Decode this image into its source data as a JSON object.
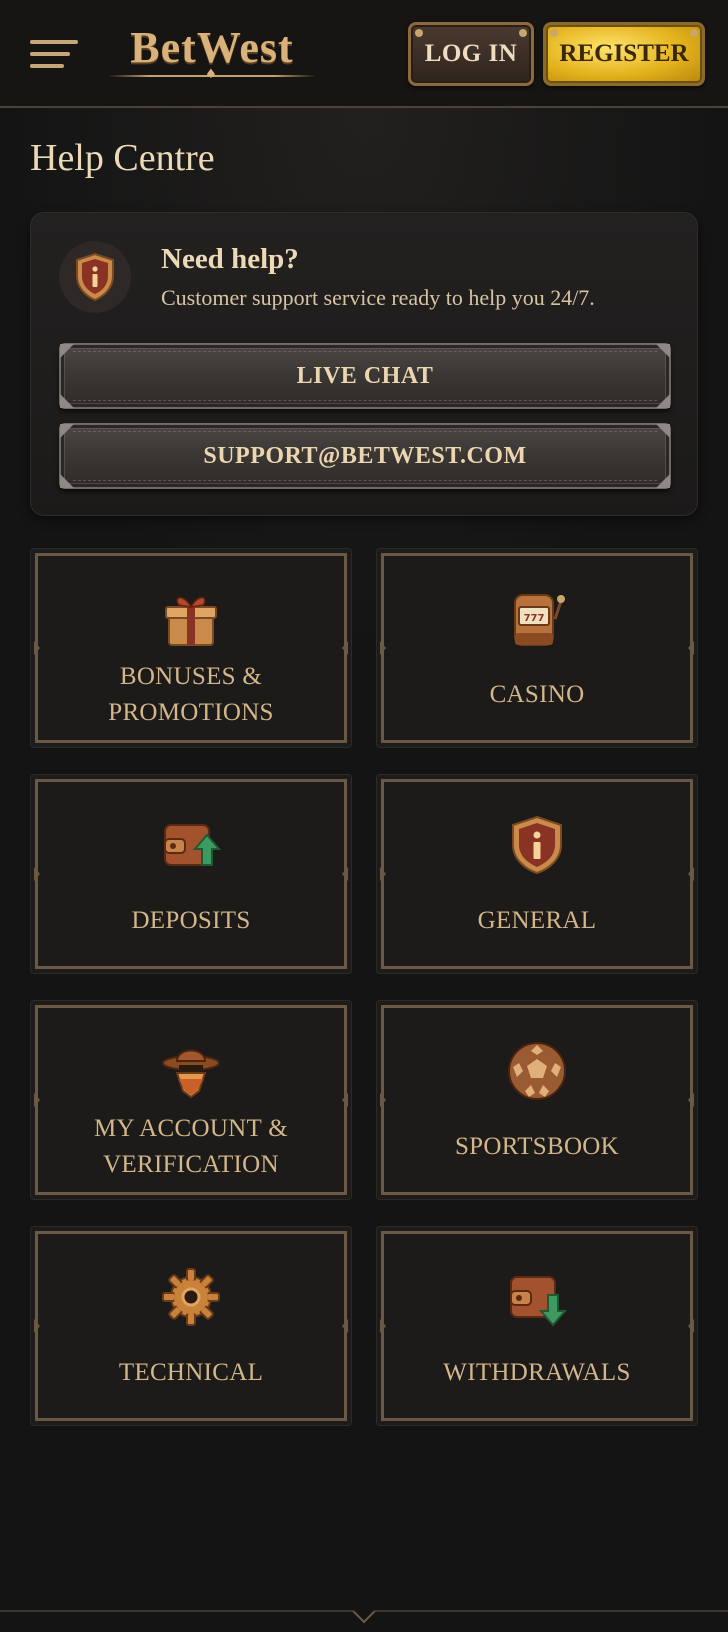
{
  "header": {
    "logo_text": "BetWest",
    "login_label": "LOG IN",
    "register_label": "REGISTER"
  },
  "page_title": "Help Centre",
  "help": {
    "title": "Need help?",
    "description": "Customer support service ready to help you 24/7.",
    "live_chat_label": "LIVE CHAT",
    "email_label": "SUPPORT@BETWEST.COM"
  },
  "categories": [
    {
      "line1": "BONUSES &",
      "line2": "PROMOTIONS",
      "icon": "gift-icon"
    },
    {
      "line1": "CASINO",
      "line2": "",
      "icon": "slot-machine-icon"
    },
    {
      "line1": "DEPOSITS",
      "line2": "",
      "icon": "wallet-deposit-icon"
    },
    {
      "line1": "GENERAL",
      "line2": "",
      "icon": "info-shield-icon"
    },
    {
      "line1": "MY ACCOUNT &",
      "line2": "VERIFICATION",
      "icon": "cowboy-icon"
    },
    {
      "line1": "SPORTSBOOK",
      "line2": "",
      "icon": "football-icon"
    },
    {
      "line1": "TECHNICAL",
      "line2": "",
      "icon": "gear-icon"
    },
    {
      "line1": "WITHDRAWALS",
      "line2": "",
      "icon": "wallet-withdraw-icon"
    }
  ],
  "colors": {
    "background": "#141414",
    "accent_gold": "#d3b68a",
    "register_gold": "#e3b21c"
  }
}
